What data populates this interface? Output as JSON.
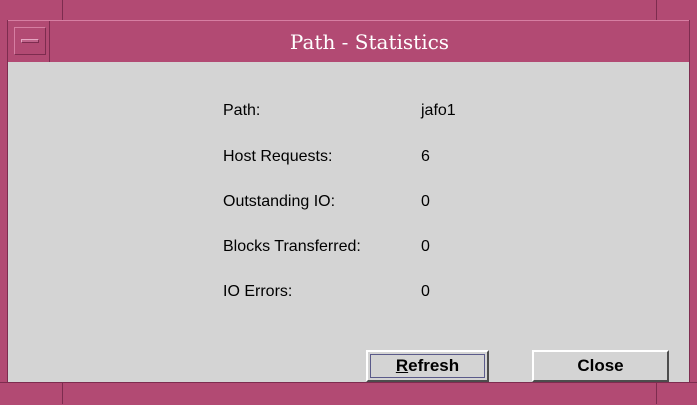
{
  "window": {
    "title": "Path - Statistics",
    "frame_color": "#b24a73",
    "background_color": "#d4d4d4"
  },
  "stats": [
    {
      "label": "Path:",
      "value": "jafo1"
    },
    {
      "label": "Host Requests:",
      "value": "6"
    },
    {
      "label": "Outstanding IO:",
      "value": "0"
    },
    {
      "label": "Blocks Transferred:",
      "value": "0"
    },
    {
      "label": "IO Errors:",
      "value": "0"
    }
  ],
  "buttons": {
    "refresh_label": "Refresh",
    "close_label": "Close"
  },
  "icons": {
    "window_menu": "window-menu-icon"
  }
}
